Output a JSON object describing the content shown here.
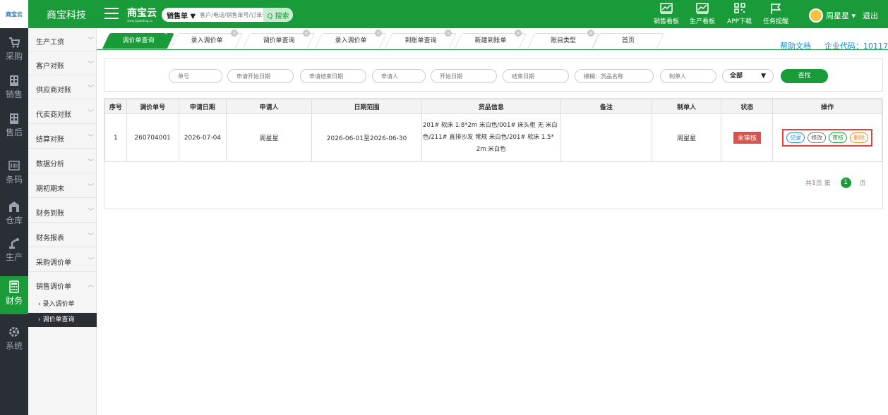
{
  "app": {
    "logo_text": "商宝云",
    "company_name": "商宝科技",
    "brand_name": "商宝云",
    "brand_url": "www.jiqiaoding.cn"
  },
  "search": {
    "selected_type": "销售单 ▼",
    "placeholder": "客户/电话/销售单号/订单号",
    "button_label": "Q 搜索"
  },
  "toolbar": {
    "sales_board": "销售看板",
    "production_board": "生产看板",
    "app_download": "APP下载",
    "task_reminder": "任务提醒"
  },
  "user": {
    "name": "周星星 ▾",
    "logout": "退出"
  },
  "rail": [
    {
      "label": "采购",
      "icon": "cart-icon"
    },
    {
      "label": "销售",
      "icon": "building-icon"
    },
    {
      "label": "售后",
      "icon": "building-icon"
    },
    {
      "label": "条码",
      "icon": "barcode-icon"
    },
    {
      "label": "仓库",
      "icon": "warehouse-icon"
    },
    {
      "label": "生产",
      "icon": "robot-arm-icon"
    },
    {
      "label": "财务",
      "icon": "calculator-icon"
    },
    {
      "label": "系统",
      "icon": "gear-icon"
    }
  ],
  "submenu": {
    "items": [
      "生产工资",
      "客户对账",
      "供应商对账",
      "代卖商对账",
      "结算对账",
      "数据分析",
      "期初期末",
      "财务到账",
      "财务报表",
      "采购调价单",
      "销售调价单"
    ],
    "sub_items": [
      "录入调价单",
      "调价单查询"
    ]
  },
  "tabs": [
    {
      "label": "调价单查询",
      "active": true
    },
    {
      "label": "录入调价单"
    },
    {
      "label": "调价单查询"
    },
    {
      "label": "录入调价单"
    },
    {
      "label": "到账单查询"
    },
    {
      "label": "新建到账单"
    },
    {
      "label": "账目类型"
    },
    {
      "label": "首页"
    }
  ],
  "header_links": {
    "help": "帮助文档",
    "corp_code": "企业代码：10117"
  },
  "filter": {
    "order_no": "单号",
    "apply_start": "申请开始日期",
    "apply_end": "申请结束日期",
    "applicant": "申请人",
    "start_date": "开始日期",
    "end_date": "结束日期",
    "fuzzy": "模糊：货品名称",
    "creator": "制单人",
    "status_selected": "全部",
    "search_btn": "查找"
  },
  "table": {
    "columns": [
      "序号",
      "调价单号",
      "申请日期",
      "申请人",
      "日期范围",
      "货品信息",
      "备注",
      "制单人",
      "状态",
      "操作"
    ],
    "rows": [
      {
        "index": "1",
        "order_no": "260704001",
        "apply_date": "2026-07-04",
        "applicant": "周星星",
        "date_range": "2026-06-01至2026-06-30",
        "goods_line1": "201# 软床 1.8*2m 米白色/001# 床头柜 无 米白",
        "goods_line2": "色/211# 直排沙发 常规 米白色/201# 软床 1.5*",
        "goods_line3": "2m 米白色",
        "remark": "",
        "creator": "周星星",
        "status": "未审核",
        "ops": {
          "record": "记录",
          "edit": "修改",
          "audit": "审核",
          "delete": "删除"
        }
      }
    ]
  },
  "pager": {
    "total_prefix": "共",
    "total_pages": "1",
    "total_suffix": "页  第",
    "current": "1",
    "page_suffix": "页"
  },
  "colors": {
    "brand_green": "#1a9b3a",
    "rail_bg": "#2a2f36",
    "status_red": "#d9534f"
  }
}
